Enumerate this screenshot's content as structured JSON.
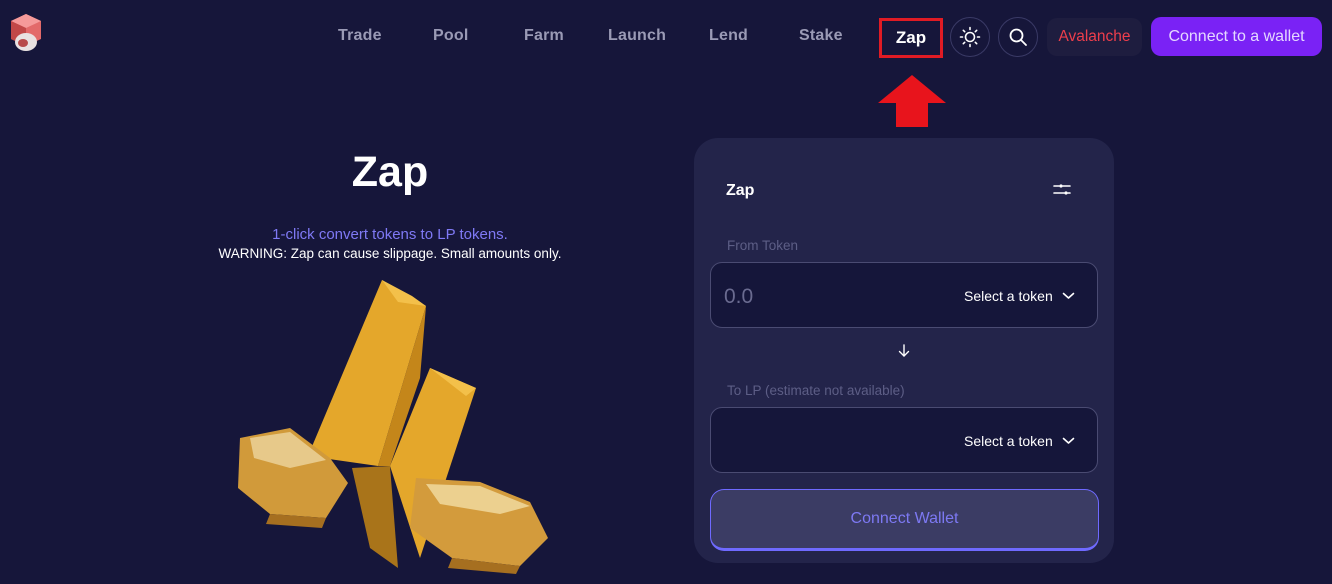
{
  "nav": {
    "items": [
      "Trade",
      "Pool",
      "Farm",
      "Launch",
      "Lend",
      "Stake"
    ],
    "active": "Zap",
    "network": "Avalanche",
    "connect_label": "Connect to a wallet"
  },
  "hero": {
    "title": "Zap",
    "subtitle": "1-click convert tokens to LP tokens.",
    "warning": "WARNING: Zap can cause slippage. Small amounts only."
  },
  "card": {
    "title": "Zap",
    "from_label": "From Token",
    "amount_placeholder": "0.0",
    "from_select": "Select a token",
    "to_label": "To LP (estimate not available)",
    "to_select": "Select a token",
    "connect_button": "Connect Wallet"
  },
  "colors": {
    "background": "#16163a",
    "accent": "#7a22f5",
    "highlight": "#e01b24",
    "network": "#ee3e4c"
  }
}
